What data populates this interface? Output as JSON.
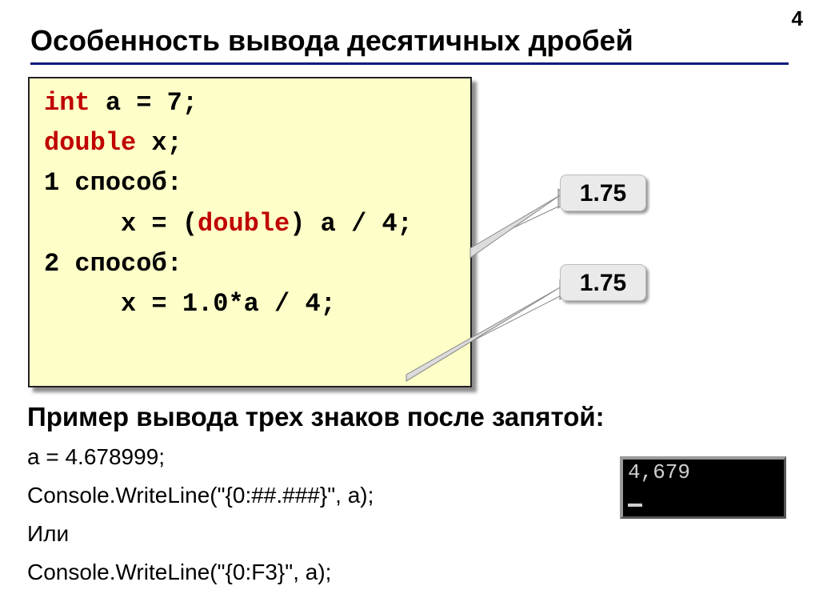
{
  "page_number": "4",
  "title": "Особенность вывода десятичных дробей",
  "code": {
    "l1a": "int",
    "l1b": " a = 7;",
    "l2a": "double",
    "l2b": " x;",
    "l3": "1 способ:",
    "l4a": "x = (",
    "l4b": "double",
    "l4c": ") a / 4;",
    "l5": "2 способ:",
    "l6": "x = 1.0*a / 4;"
  },
  "badges": {
    "b1": "1.75",
    "b2": "1.75"
  },
  "subtitle": "Пример вывода трех знаков после запятой:",
  "lines": {
    "l1": "a = 4.678999;",
    "l2": "Console.WriteLine(\"{0:##.###}\", a);",
    "l3": "Или",
    "l4": "Console.WriteLine(\"{0:F3}\", a);"
  },
  "console_output": "4,679"
}
